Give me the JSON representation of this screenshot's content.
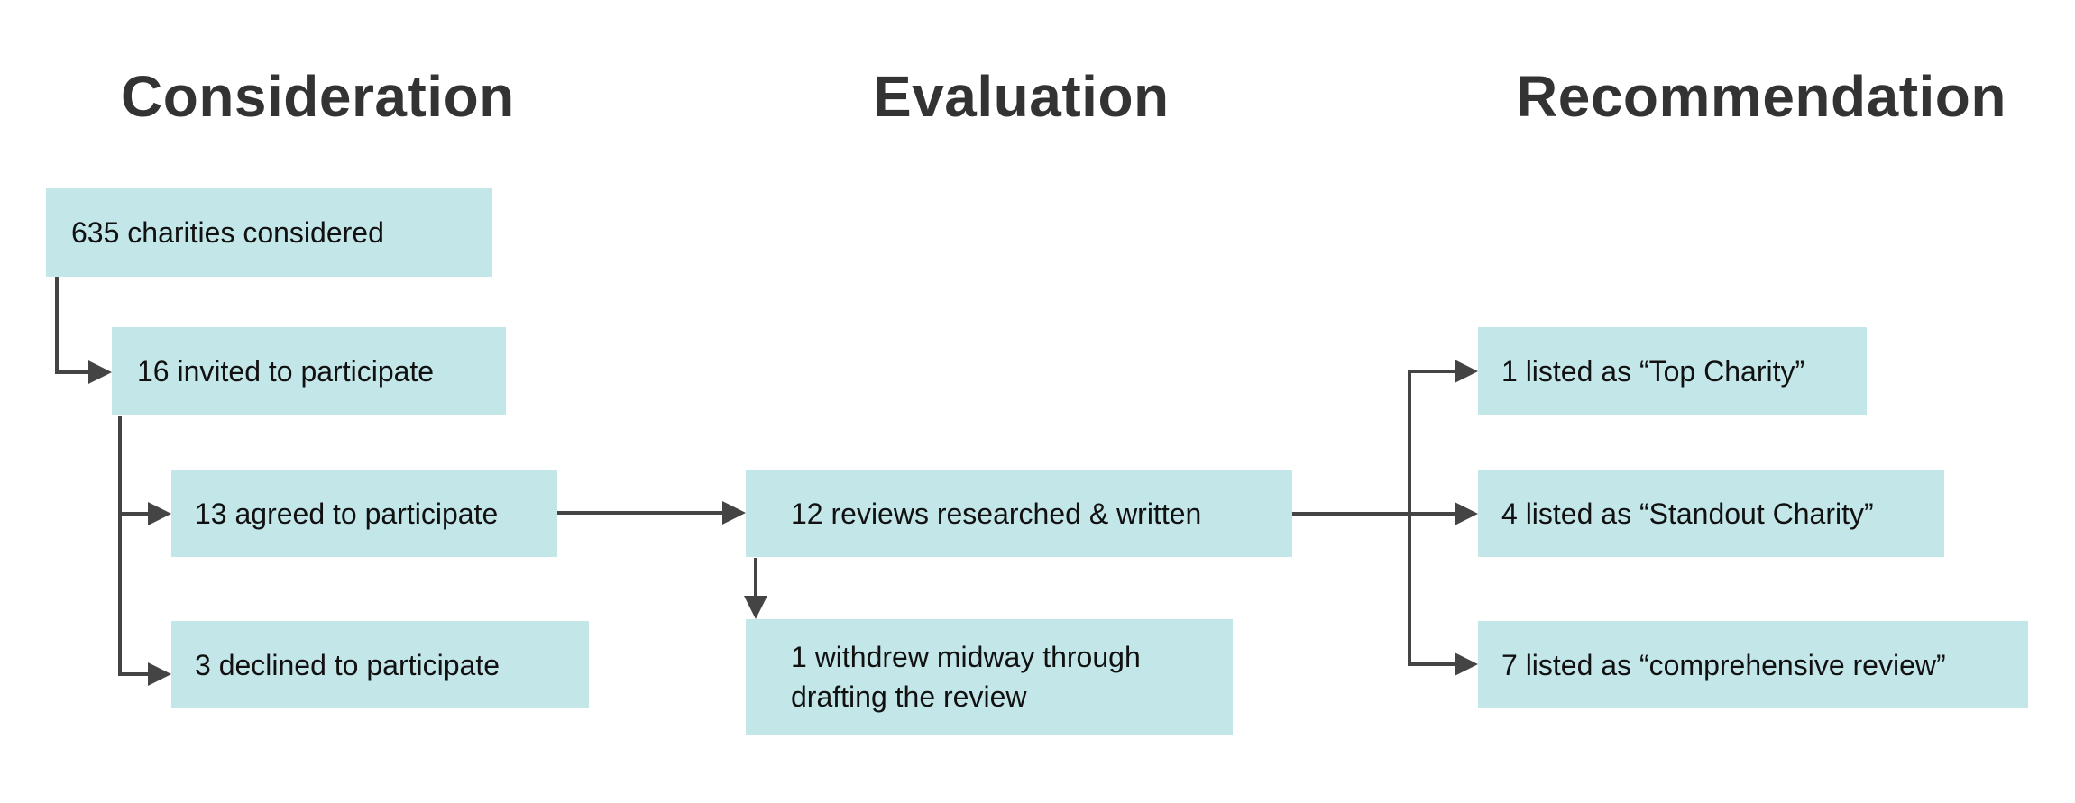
{
  "stages": [
    {
      "title": "Consideration"
    },
    {
      "title": "Evaluation"
    },
    {
      "title": "Recommendation"
    }
  ],
  "nodes": {
    "considered": "635 charities considered",
    "invited": "16 invited to participate",
    "agreed": "13 agreed to participate",
    "declined": "3 declined to participate",
    "reviews": "12 reviews researched & written",
    "withdrew_line1": "1 withdrew midway through",
    "withdrew_line2": "drafting the review",
    "top_charity": "1 listed as “Top Charity”",
    "standout": "4 listed as “Standout Charity”",
    "comprehensive": "7 listed as “comprehensive review”"
  },
  "edges": [
    {
      "from": "considered",
      "to": "invited"
    },
    {
      "from": "invited",
      "to": "agreed"
    },
    {
      "from": "invited",
      "to": "declined"
    },
    {
      "from": "agreed",
      "to": "reviews"
    },
    {
      "from": "reviews",
      "to": "withdrew"
    },
    {
      "from": "reviews",
      "to": "top_charity"
    },
    {
      "from": "reviews",
      "to": "standout"
    },
    {
      "from": "reviews",
      "to": "comprehensive"
    }
  ],
  "colors": {
    "box_fill": "#c3e6e8",
    "connector": "#444444",
    "title_text": "#333333"
  }
}
